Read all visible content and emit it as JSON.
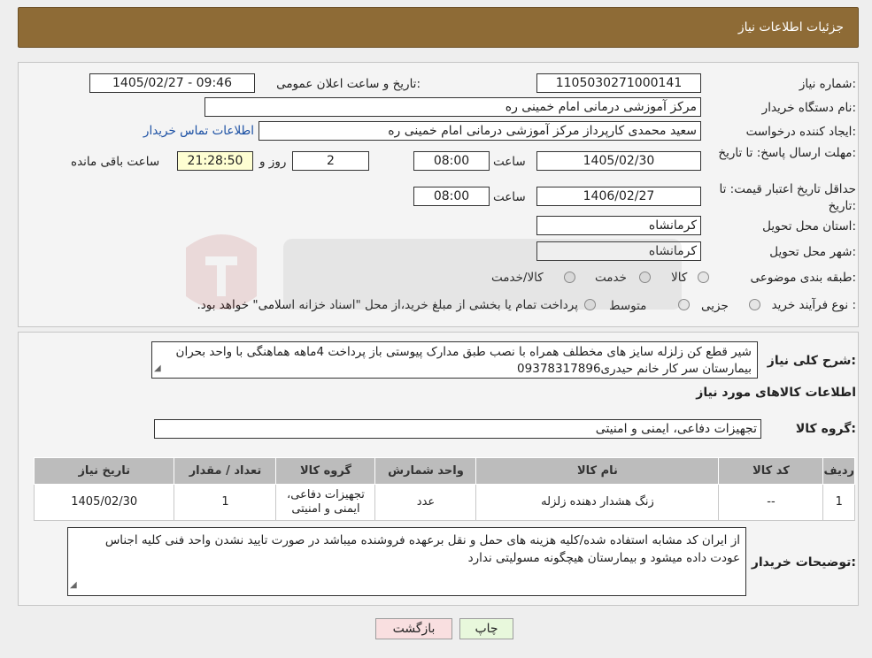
{
  "header": {
    "title": "جزئیات اطلاعات نیاز"
  },
  "fields": {
    "need_number_label": "شماره نیاز:",
    "need_number": "1105030271000141",
    "announce_label": "تاریخ و ساعت اعلان عمومی:",
    "announce_value": "1405/02/27 - 09:46",
    "buyer_org_label": "نام دستگاه خریدار:",
    "buyer_org": "مرکز آموزشی درمانی امام خمینی ره",
    "creator_label": "ایجاد کننده درخواست:",
    "creator": "سعید محمدی کارپرداز مرکز آموزشی درمانی امام خمینی ره",
    "contact_link": "اطلاعات تماس خریدار",
    "deadline_label": "مهلت ارسال پاسخ: تا تاریخ:",
    "deadline_date": "1405/02/30",
    "time_label": "ساعت",
    "deadline_time": "08:00",
    "days_value": "2",
    "days_label": "روز و",
    "remaining_time": "21:28:50",
    "remaining_label": "ساعت باقی مانده",
    "validity_label": "حداقل تاریخ اعتبار قیمت: تا تاریخ:",
    "validity_date": "1406/02/27",
    "validity_time": "08:00",
    "province_label": "استان محل تحویل:",
    "province": "کرمانشاه",
    "city_label": "شهر محل تحویل:",
    "city": "کرمانشاه",
    "category_label": "طبقه بندی موضوعی:",
    "category_options": [
      "کالا",
      "خدمت",
      "کالا/خدمت"
    ],
    "process_label": "نوع فرآیند خرید :",
    "process_options": [
      "جزیی",
      "متوسط"
    ],
    "process_note": "پرداخت تمام یا بخشی از مبلغ خرید،از محل \"اسناد خزانه اسلامی\" خواهد بود."
  },
  "description": {
    "label": "شرح کلی نیاز:",
    "text": "شیر قطع کن زلزله سایز های مخطلف همراه با نصب طبق مدارک پیوستی باز پرداخت 4ماهه هماهنگی با واحد بحران بیمارستان سر کار خانم حیدری09378317896"
  },
  "goods": {
    "section_title": "اطلاعات کالاهای مورد نیاز",
    "group_label": "گروه کالا:",
    "group_value": "تجهیزات دفاعی، ایمنی و امنیتی",
    "columns": [
      "ردیف",
      "کد کالا",
      "نام کالا",
      "واحد شمارش",
      "گروه کالا",
      "تعداد / مقدار",
      "تاریخ نیاز"
    ],
    "rows": [
      {
        "row": "1",
        "code": "--",
        "name": "زنگ هشدار دهنده زلزله",
        "unit": "عدد",
        "group": "تجهیزات دفاعی، ایمنی و امنیتی",
        "qty": "1",
        "date": "1405/02/30"
      }
    ]
  },
  "buyer_notes": {
    "label": "توضیحات خریدار:",
    "text": "از ایران کد مشابه استفاده شده/کلیه هزینه های حمل و نقل برعهده فروشنده میباشد در صورت تایید نشدن واحد فنی کلیه اجناس عودت داده میشود و بیمارستان هیچگونه مسولیتی ندارد"
  },
  "buttons": {
    "print": "چاپ",
    "back": "بازگشت"
  },
  "colors": {
    "header_bg": "#8e6b36",
    "link": "#1a4fa3",
    "print_bg": "#e8f8dc",
    "back_bg": "#f9dfe0"
  }
}
